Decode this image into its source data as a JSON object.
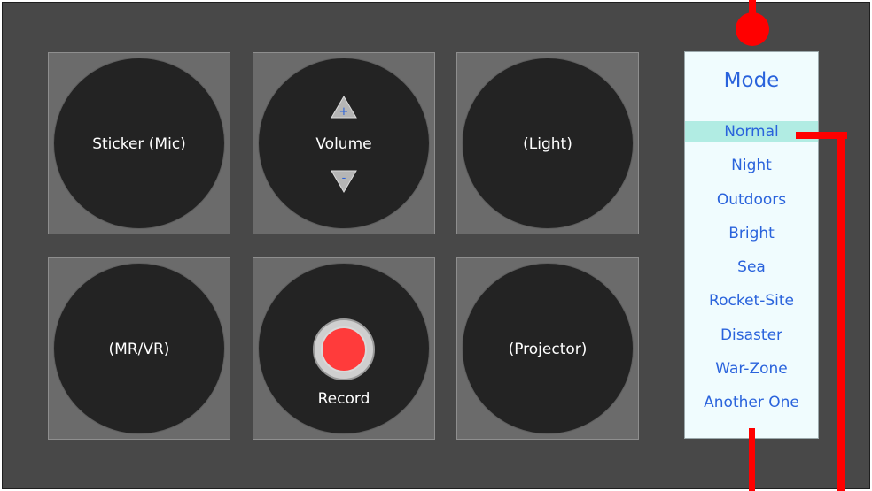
{
  "buttons": {
    "sticker": "Sticker (Mic)",
    "volume": "Volume",
    "volume_up": "+",
    "volume_down": "-",
    "light": "(Light)",
    "mrvr": "(MR/VR)",
    "record": "Record",
    "projector": "(Projector)"
  },
  "mode": {
    "title": "Mode",
    "items": [
      {
        "label": "Normal",
        "selected": true
      },
      {
        "label": "Night"
      },
      {
        "label": "Outdoors"
      },
      {
        "label": "Bright"
      },
      {
        "label": "Sea"
      },
      {
        "label": "Rocket-Site"
      },
      {
        "label": "Disaster"
      },
      {
        "label": "War-Zone"
      },
      {
        "label": "Another One"
      }
    ]
  },
  "colors": {
    "panel_bg": "#484848",
    "tile_bg": "#6b6b6b",
    "knob_bg": "#232323",
    "mode_text": "#2a63dc",
    "mode_selected_bg": "#b1ece3",
    "record_red": "#ff3b3b",
    "wire_red": "#ff0000"
  }
}
